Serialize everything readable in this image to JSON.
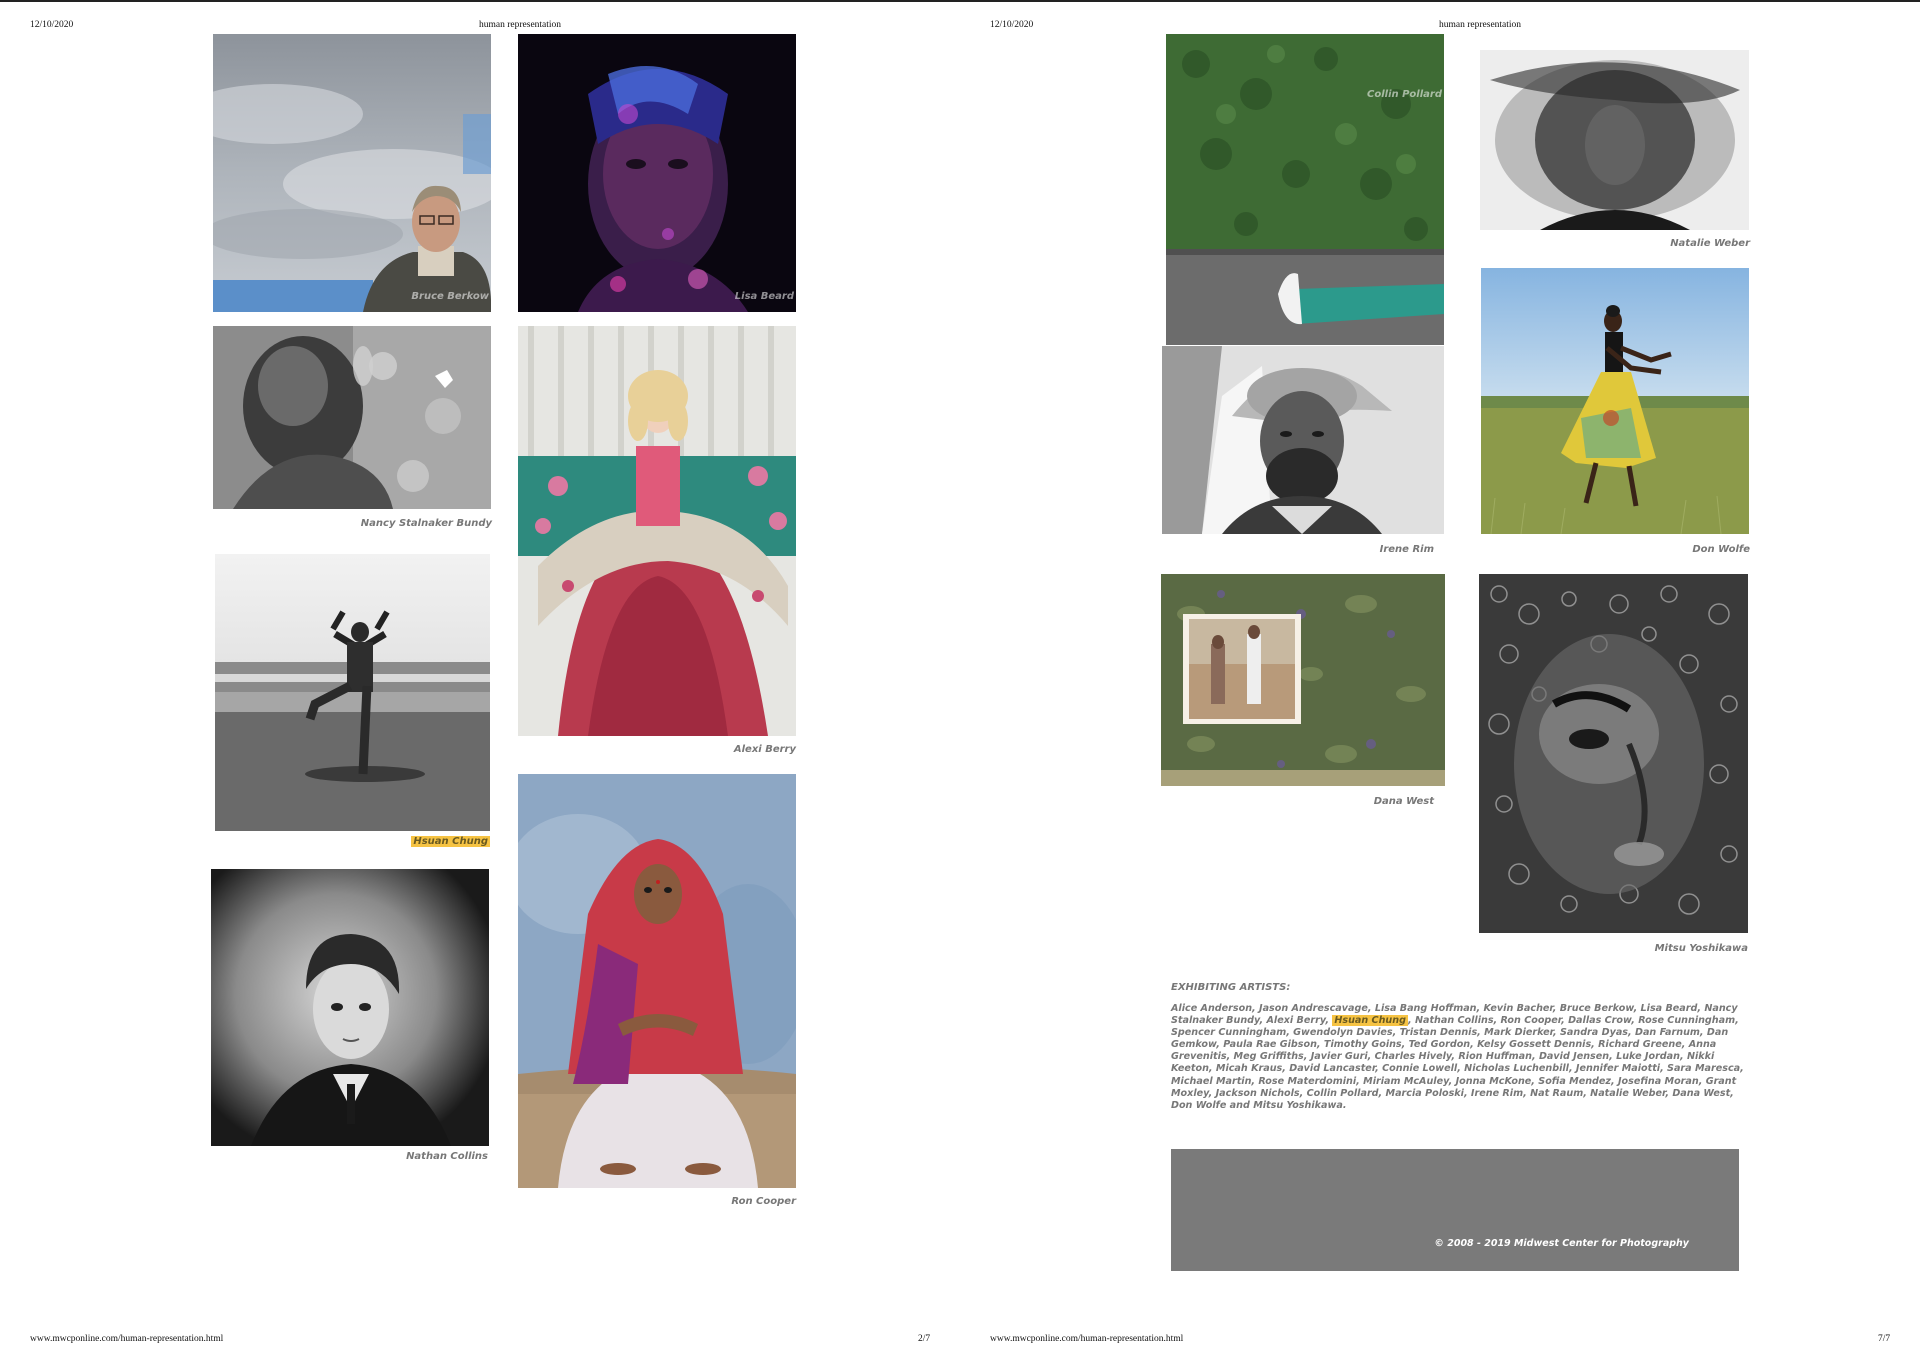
{
  "left_page": {
    "header_date": "12/10/2020",
    "header_title": "human representation",
    "footer_url": "www.mwcponline.com/human-representation.html",
    "footer_page": "2/7",
    "photos": {
      "bruce_berkow": {
        "caption": "",
        "watermark": "Bruce Berkow"
      },
      "lisa_beard": {
        "caption": "",
        "watermark": "Lisa Beard"
      },
      "nancy_stalnaker_bundy": {
        "caption": "Nancy Stalnaker Bundy"
      },
      "alexi_berry": {
        "caption": "Alexi Berry"
      },
      "hsuan_chung": {
        "caption": "Hsuan Chung"
      },
      "nathan_collins": {
        "caption": "Nathan Collins"
      },
      "ron_cooper": {
        "caption": "Ron Cooper"
      }
    }
  },
  "right_page": {
    "header_date": "12/10/2020",
    "header_title": "human representation",
    "footer_url": "www.mwcponline.com/human-representation.html",
    "footer_page": "7/7",
    "photos": {
      "collin_pollard": {
        "caption": "",
        "watermark": "Collin Pollard"
      },
      "natalie_weber": {
        "caption": "Natalie Weber"
      },
      "irene_rim": {
        "caption": "Irene Rim"
      },
      "don_wolfe": {
        "caption": "Don Wolfe"
      },
      "dana_west": {
        "caption": "Dana West"
      },
      "mitsu_yoshikawa": {
        "caption": "Mitsu Yoshikawa"
      }
    },
    "exhibiting_heading": "EXHIBITING ARTISTS:",
    "artists_before": "Alice Anderson, Jason Andrescavage, Lisa Bang Hoffman, Kevin Bacher, Bruce Berkow, Lisa Beard, Nancy Stalnaker Bundy, Alexi Berry, ",
    "artists_highlight": "Hsuan Chung",
    "artists_after": ", Nathan Collins, Ron Cooper, Dallas Crow, Rose Cunningham, Spencer Cunningham, Gwendolyn Davies, Tristan Dennis, Mark Dierker, Sandra Dyas, Dan Farnum, Dan Gemkow, Paula Rae Gibson, Timothy Goins, Ted Gordon, Kelsy Gossett Dennis, Richard Greene, Anna Grevenitis, Meg Griffiths, Javier Guri, Charles Hively, Rion Huffman, David Jensen, Luke Jordan, Nikki Keeton, Micah Kraus, David Lancaster, Connie Lowell, Nicholas Luchenbill, Jennifer Maiotti, Sara Maresca, Michael Martin, Rose Materdomini, Miriam McAuley, Jonna McKone, Sofia Mendez, Josefina Moran, Grant Moxley, Jackson Nichols, Collin Pollard, Marcia Poloski, Irene Rim, Nat Raum, Natalie Weber, Dana West, Don Wolfe and Mitsu Yoshikawa.",
    "copyright": "© 2008 - 2019 Midwest Center for Photography"
  },
  "colors": {
    "highlight": "#f6c343",
    "caption_text": "#777777",
    "footer_box": "#7a7a7a"
  }
}
